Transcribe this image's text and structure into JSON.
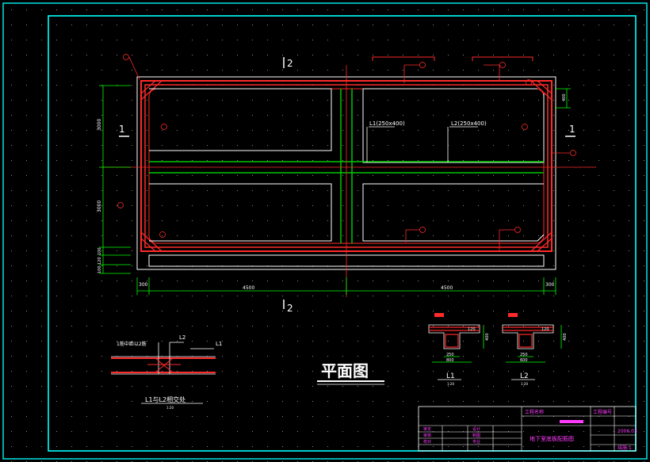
{
  "colors": {
    "background": "#000000",
    "frame": "#00e5e5",
    "outline": "#ffffff",
    "rebar": "#ff2a2a",
    "beam": "#00c800",
    "dimension": "#00ff00",
    "label_magenta": "#ff3cff",
    "grid_dot": "#8a8a8a"
  },
  "plan": {
    "title": "平面图",
    "section_marks": {
      "left": "1",
      "right": "1",
      "top": "2",
      "bottom": "2"
    },
    "beam_labels": {
      "l1": "L1(250x400)",
      "l2": "L2(250x400)"
    },
    "bottom_dims": [
      "300",
      "4500",
      "4500",
      "300"
    ],
    "left_dims": [
      "3000",
      "3000"
    ],
    "left_dims_small": [
      "100",
      "120",
      "100"
    ],
    "right_dim": "400"
  },
  "sections": [
    {
      "name": "L1",
      "scale": "1:20",
      "width_dim": "250",
      "sub_dim": "800",
      "height_dim": "400",
      "slab_dim": "120"
    },
    {
      "name": "L2",
      "scale": "1:20",
      "width_dim": "250",
      "sub_dim": "600",
      "height_dim": "400",
      "slab_dim": "120"
    }
  ],
  "joint_detail": {
    "label_l1": "L1",
    "label_l2": "L2",
    "note": "1筋中距以2筋",
    "caption": "L1与L2相交处",
    "scale": "1:20"
  },
  "title_block": {
    "design_unit": "工程名称",
    "project_no": "工程编号",
    "drawing_title": "地下室底板配筋图",
    "date": "2006.03",
    "sheet": "结施-1",
    "rows_left": [
      "审定",
      "审核",
      "校对"
    ],
    "rows_mid": [
      "设计",
      "制图",
      "专业"
    ]
  }
}
